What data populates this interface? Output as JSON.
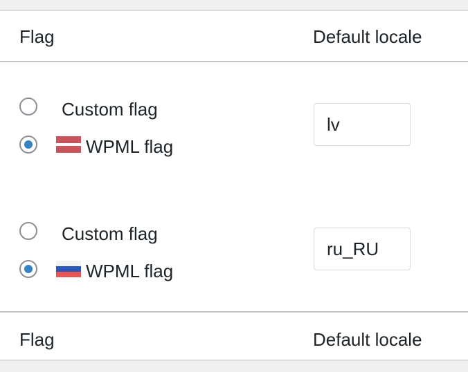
{
  "table": {
    "header": {
      "flag": "Flag",
      "default_locale": "Default locale"
    },
    "footer": {
      "flag": "Flag",
      "default_locale": "Default locale"
    },
    "rows": [
      {
        "options": [
          {
            "label": "Custom flag",
            "selected": false
          },
          {
            "label": "WPML flag",
            "selected": true,
            "flag_icon": "latvia-flag-icon"
          }
        ],
        "locale_value": "lv"
      },
      {
        "options": [
          {
            "label": "Custom flag",
            "selected": false
          },
          {
            "label": "WPML flag",
            "selected": true,
            "flag_icon": "russia-flag-icon"
          }
        ],
        "locale_value": "ru_RU"
      }
    ]
  },
  "colors": {
    "radio_checked": "#3582c4",
    "latvia_red": "#c9545b",
    "russia_white": "#f2f2f2",
    "russia_blue": "#2a56b8",
    "russia_red": "#e85555"
  }
}
